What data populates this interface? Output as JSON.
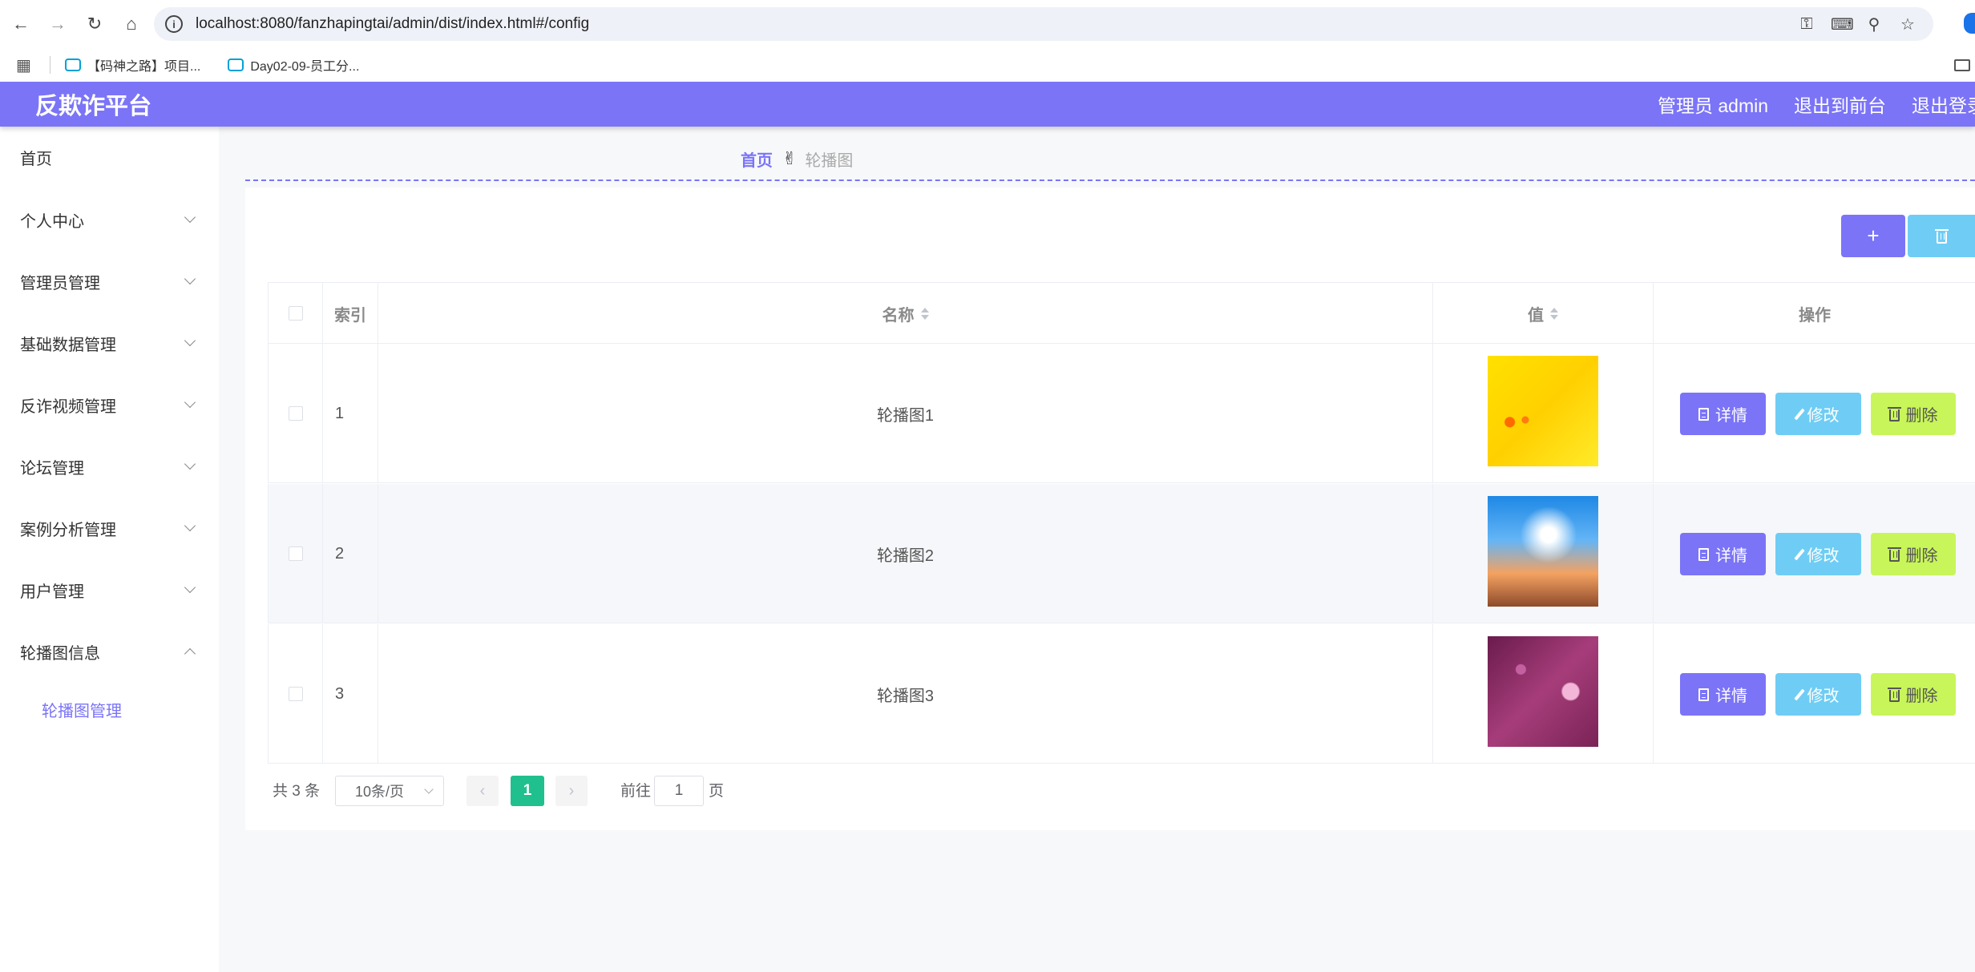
{
  "browser": {
    "url": "localhost:8080/fanzhapingtai/admin/dist/index.html#/config",
    "bookmarks": [
      "【码神之路】项目...",
      "Day02-09-员工分..."
    ]
  },
  "header": {
    "title": "反欺诈平台",
    "user": "管理员 admin",
    "to_front": "退出到前台",
    "logout": "退出登录"
  },
  "sidebar": {
    "items": [
      {
        "label": "首页"
      },
      {
        "label": "个人中心"
      },
      {
        "label": "管理员管理"
      },
      {
        "label": "基础数据管理"
      },
      {
        "label": "反诈视频管理"
      },
      {
        "label": "论坛管理"
      },
      {
        "label": "案例分析管理"
      },
      {
        "label": "用户管理"
      },
      {
        "label": "轮播图信息"
      }
    ],
    "sub_item": "轮播图管理"
  },
  "breadcrumb": {
    "home": "首页",
    "current": "轮播图"
  },
  "toolbar": {
    "add_label": "+"
  },
  "table": {
    "headers": {
      "index": "索引",
      "name": "名称",
      "value": "值",
      "actions": "操作"
    },
    "rows": [
      {
        "index": "1",
        "name": "轮播图1"
      },
      {
        "index": "2",
        "name": "轮播图2"
      },
      {
        "index": "3",
        "name": "轮播图3"
      }
    ],
    "action_labels": {
      "detail": "详情",
      "edit": "修改",
      "delete": "删除"
    }
  },
  "pagination": {
    "total": "共 3 条",
    "page_size": "10条/页",
    "current_page": "1",
    "goto_label": "前往",
    "goto_value": "1",
    "page_suffix": "页"
  },
  "colors": {
    "primary": "#7b74f7",
    "info": "#6fcdf5",
    "warning": "#c8f55a",
    "active_page": "#1fc08d"
  }
}
